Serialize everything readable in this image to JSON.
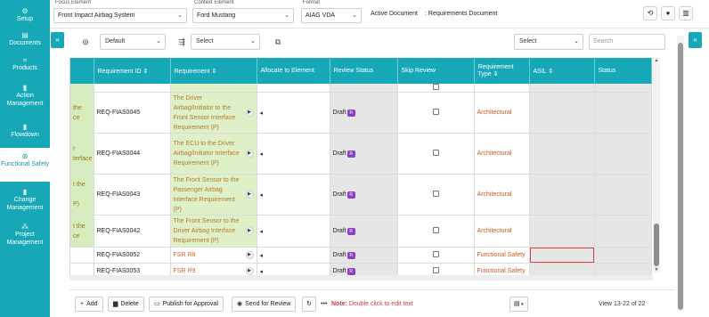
{
  "sidebar": {
    "items": [
      {
        "label": "Setup",
        "icon": "gear-icon"
      },
      {
        "label": "Documents",
        "icon": "document-icon"
      },
      {
        "label": "Products",
        "icon": "product-icon"
      },
      {
        "label": "Action Management",
        "icon": "action-icon"
      },
      {
        "label": "Flowdown",
        "icon": "flowdown-icon"
      },
      {
        "label": "Functional Safety",
        "icon": "shield-icon",
        "active": true
      },
      {
        "label": "Change Management",
        "icon": "change-icon"
      },
      {
        "label": "Project Management",
        "icon": "project-icon"
      }
    ]
  },
  "header": {
    "focus_label": "Focus Element",
    "focus_value": "Front Impact Airbag System",
    "context_label": "Context Element",
    "context_value": "Ford Mustang",
    "format_label": "Format",
    "format_value": "AIAG VDA",
    "active_doc_label": "Active Document",
    "active_doc_value": ": Requirements Document"
  },
  "filters": {
    "view_value": "Default",
    "select_value": "Select",
    "right_select_value": "Select",
    "search_placeholder": "Search"
  },
  "table": {
    "columns": [
      "Requirement ID",
      "Requirement",
      "Allocate to Element",
      "Review Status",
      "Skip Review",
      "Requirement Type",
      "ASIL",
      "Status"
    ],
    "rows": [
      {
        "frag": "",
        "id": "",
        "req": "",
        "review": "",
        "type": "",
        "partial": true
      },
      {
        "frag": "the\nce",
        "id": "REQ-FIAS0045",
        "req": "The Driver Airbag/Initiator to the Front Sensor Interface Requirement (P)",
        "review": "Draft",
        "badge": "R",
        "type": "Architectural",
        "green": true
      },
      {
        "frag": "r\nterface",
        "id": "REQ-FIAS0044",
        "req": "The ECU to the Driver Airbag/Initiator Interface Requirement (P)",
        "review": "Draft",
        "badge": "R",
        "type": "Architectural",
        "green": true
      },
      {
        "frag": "t the\n\nP)",
        "id": "REQ-FIAS0043",
        "req": "The Front Sensor to the Passenger Airbag Interface Requirement (P)",
        "review": "Draft",
        "badge": "R",
        "type": "Architectural",
        "green": true
      },
      {
        "frag": "t the\nce",
        "id": "REQ-FIAS0042",
        "req": "The Front Sensor to the Driver Airbag Interface Requirement (P)",
        "review": "Draft",
        "badge": "R",
        "type": "Architectural",
        "green": true
      },
      {
        "frag": "",
        "id": "REQ-FIAS0052",
        "req": "FSR R8",
        "review": "Draft",
        "badge": "R",
        "type": "Functional Safety",
        "green": false,
        "selected": true
      },
      {
        "frag": "",
        "id": "REQ-FIAS0053",
        "req": "FSR R9",
        "review": "Draft",
        "badge": "R",
        "type": "Functional Safety",
        "green": false
      }
    ]
  },
  "footer": {
    "add_label": "Add",
    "delete_label": "Delete",
    "publish_label": "Publish for Approval",
    "send_label": "Send for Review",
    "note_label": "Note:",
    "note_text": "Double click to edit text",
    "page_info": "View 13-22 of 22"
  }
}
